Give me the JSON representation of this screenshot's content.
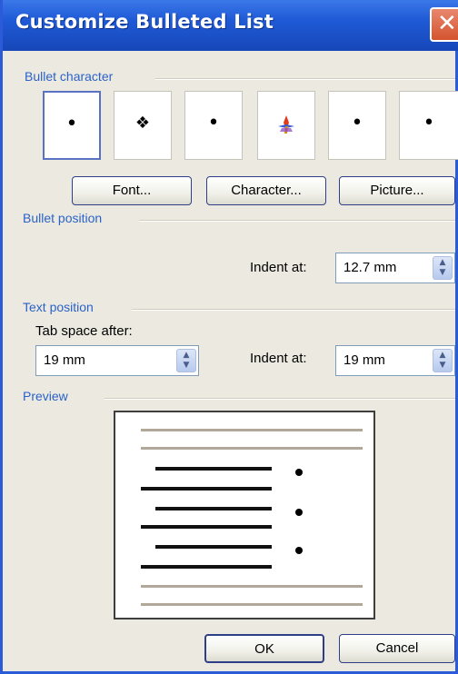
{
  "dialog": {
    "title": "Customize Bulleted List",
    "close_glyph": "✕"
  },
  "bullet_character": {
    "label": "Bullet character",
    "bullets": [
      {
        "glyph": "•",
        "selected": true
      },
      {
        "glyph": "❖",
        "selected": false
      },
      {
        "glyph": "•",
        "selected": false
      },
      {
        "glyph": "✦",
        "selected": false
      },
      {
        "glyph": "•",
        "selected": false
      },
      {
        "glyph": "•",
        "selected": false
      }
    ],
    "font_button": "Font...",
    "character_button": "Character...",
    "picture_button": "Picture..."
  },
  "bullet_position": {
    "label": "Bullet position",
    "indent_label": "Indent at:",
    "indent_value": "12.7 mm"
  },
  "text_position": {
    "label": "Text position",
    "tab_label": "Tab space after:",
    "tab_value": "19 mm",
    "indent_label": "Indent at:",
    "indent_value": "19 mm"
  },
  "preview": {
    "label": "Preview"
  },
  "footer": {
    "ok_label": "OK",
    "cancel_label": "Cancel"
  },
  "colors": {
    "title_bar": "#1f5ad6",
    "group_label": "#2a62c9",
    "close_button": "#d4542f",
    "dialog_bg": "#eceae0"
  }
}
